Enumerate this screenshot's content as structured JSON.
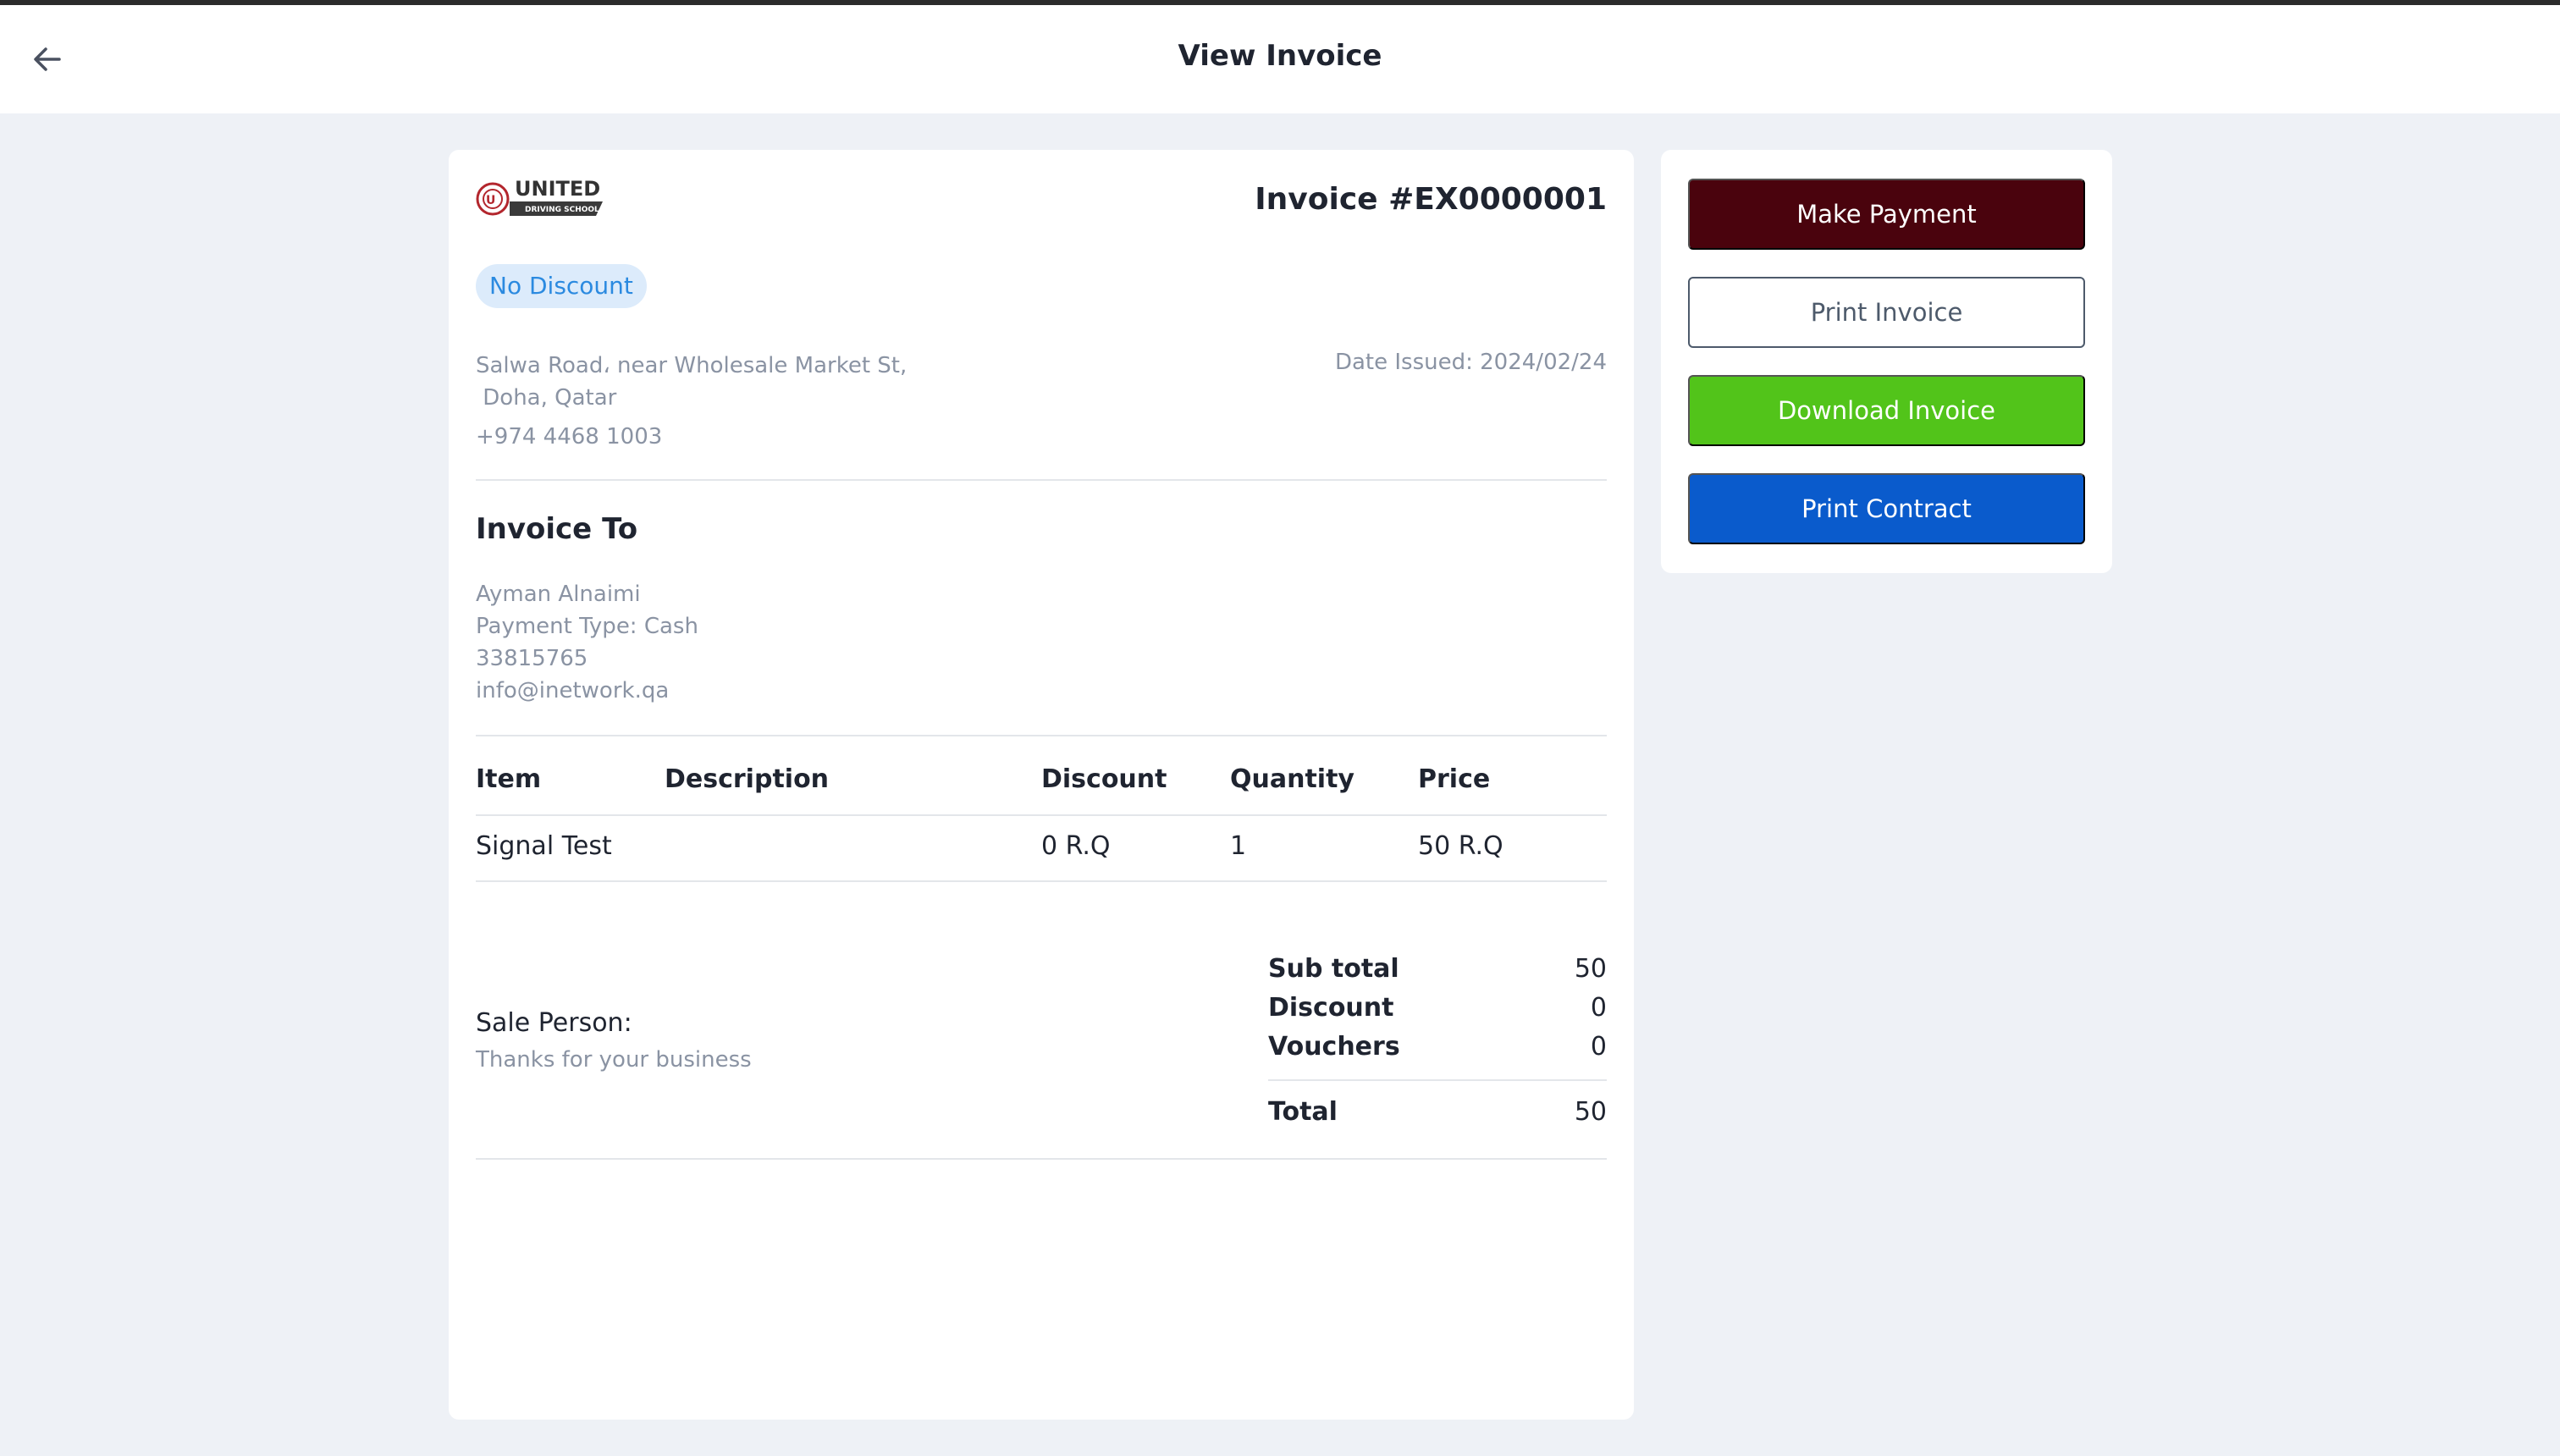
{
  "header": {
    "title": "View Invoice",
    "back_icon": "arrow-left-icon"
  },
  "invoice": {
    "logo_text": "UNITED",
    "logo_subtext": "DRIVING SCHOOL",
    "number": "Invoice #EX0000001",
    "discount_badge": "No Discount",
    "address_line1": "Salwa Road، near Wholesale Market St,",
    "address_line2": " Doha, Qatar",
    "phone": "+974 4468 1003",
    "date_issued": "Date Issued: 2024/02/24",
    "invoice_to_title": "Invoice To",
    "client": {
      "name": "Ayman Alnaimi",
      "payment_type": "Payment Type: Cash",
      "phone": "33815765",
      "email": "info@inetwork.qa"
    },
    "table": {
      "headers": [
        "Item",
        "Description",
        "Discount",
        "Quantity",
        "Price"
      ],
      "rows": [
        [
          "Signal Test",
          "",
          "0 R.Q",
          "1",
          "50 R.Q"
        ]
      ]
    },
    "sale_person_label": "Sale Person:",
    "thanks": "Thanks for your business",
    "totals": {
      "subtotal_label": "Sub total",
      "subtotal_value": "50",
      "discount_label": "Discount",
      "discount_value": "0",
      "vouchers_label": "Vouchers",
      "vouchers_value": "0",
      "total_label": "Total",
      "total_value": "50"
    }
  },
  "actions": {
    "make_payment": "Make Payment",
    "print_invoice": "Print Invoice",
    "download_invoice": "Download Invoice",
    "print_contract": "Print Contract"
  },
  "colors": {
    "make_payment_bg": "#4a030d",
    "download_bg": "#52c41a",
    "print_contract_bg": "#0a5bcc",
    "badge_bg": "#dcebfb",
    "badge_text": "#2b8ae0"
  }
}
